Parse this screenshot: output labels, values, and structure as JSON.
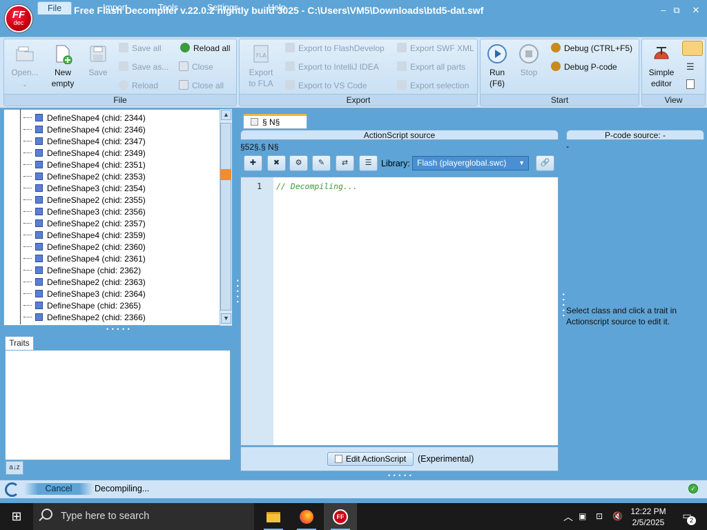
{
  "window": {
    "title": "JPEXS Free Flash Decompiler v.22.0.2 nightly build 3025 - C:\\Users\\VM5\\Downloads\\btd5-dat.swf",
    "logo_text": "FF",
    "logo_sub": "dec",
    "minimize": "–",
    "maximize": "⧉",
    "close": "✕"
  },
  "menu": {
    "file": "File",
    "import": "Import",
    "tools": "Tools",
    "settings": "Settings",
    "help": "Help"
  },
  "ribbon": {
    "file_group": {
      "label": "File",
      "open": "Open...",
      "new_line1": "New",
      "new_line2": "empty",
      "save": "Save",
      "save_all": "Save all",
      "save_as": "Save as...",
      "reload": "Reload",
      "reload_all": "Reload all",
      "close": "Close",
      "close_all": "Close all"
    },
    "export_group": {
      "label": "Export",
      "export_fla_line1": "Export",
      "export_fla_line2": "to FLA",
      "export_flashdevelop": "Export to FlashDevelop",
      "export_intellij": "Export to IntelliJ IDEA",
      "export_vscode": "Export to VS Code",
      "export_swf_xml": "Export SWF XML",
      "export_all_parts": "Export all parts",
      "export_selection": "Export selection"
    },
    "start_group": {
      "label": "Start",
      "run_line1": "Run",
      "run_line2": "(F6)",
      "stop": "Stop",
      "debug": "Debug (CTRL+F5)",
      "debug_pcode": "Debug P-code"
    },
    "view_group": {
      "label": "View",
      "simple_editor_line1": "Simple",
      "simple_editor_line2": "editor"
    }
  },
  "tree": {
    "items": [
      {
        "label": "DefineShape4 (chid: 2344)"
      },
      {
        "label": "DefineShape4 (chid: 2346)"
      },
      {
        "label": "DefineShape4 (chid: 2347)"
      },
      {
        "label": "DefineShape4 (chid: 2349)"
      },
      {
        "label": "DefineShape4 (chid: 2351)"
      },
      {
        "label": "DefineShape2 (chid: 2353)"
      },
      {
        "label": "DefineShape3 (chid: 2354)"
      },
      {
        "label": "DefineShape2 (chid: 2355)"
      },
      {
        "label": "DefineShape3 (chid: 2356)"
      },
      {
        "label": "DefineShape2 (chid: 2357)"
      },
      {
        "label": "DefineShape4 (chid: 2359)"
      },
      {
        "label": "DefineShape2 (chid: 2360)"
      },
      {
        "label": "DefineShape4 (chid: 2361)"
      },
      {
        "label": "DefineShape (chid: 2362)"
      },
      {
        "label": "DefineShape2 (chid: 2363)"
      },
      {
        "label": "DefineShape3 (chid: 2364)"
      },
      {
        "label": "DefineShape (chid: 2365)"
      },
      {
        "label": "DefineShape2 (chid: 2366)"
      }
    ]
  },
  "traits": {
    "tab_label": "Traits",
    "sort_label": "a↓z"
  },
  "editor": {
    "tab_label": "§ N§",
    "actionscript_header": "ActionScript source",
    "pcode_header": "P-code source: -",
    "class_path": "§52§.§ N§",
    "pcode_dash": "-",
    "library_label": "Library:",
    "library_value": "Flash (playerglobal.swc)",
    "line_number": "1",
    "code": "// Decompiling...",
    "edit_button": "Edit ActionScript",
    "experimental": "(Experimental)",
    "pcode_hint": "Select class and click a trait in Actionscript source to edit it."
  },
  "status": {
    "cancel": "Cancel",
    "text": "Decompiling..."
  },
  "taskbar": {
    "search_placeholder": "Type here to search",
    "time": "12:22 PM",
    "date": "2/5/2025",
    "notification_count": "2"
  }
}
